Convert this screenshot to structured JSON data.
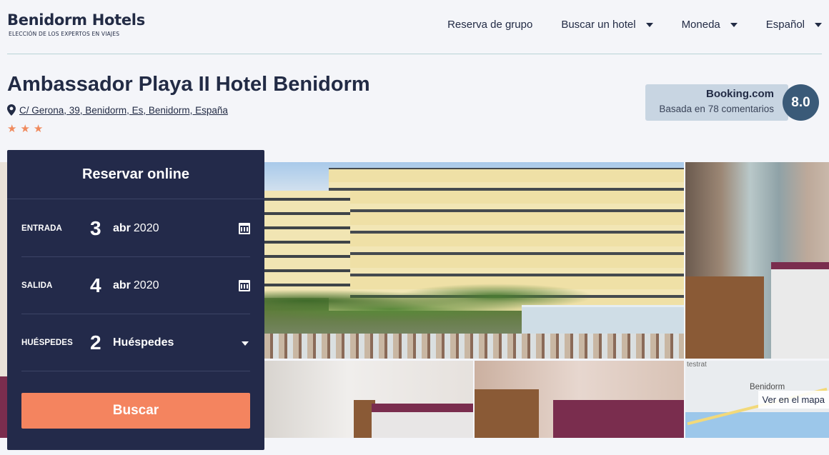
{
  "header": {
    "logo_title": "Benidorm Hotels",
    "logo_subtitle": "ELECCIÓN DE LOS EXPERTOS EN VIAJES",
    "nav": [
      {
        "label": "Reserva de grupo",
        "dropdown": false
      },
      {
        "label": "Buscar un hotel",
        "dropdown": true
      },
      {
        "label": "Moneda",
        "dropdown": true
      },
      {
        "label": "Español",
        "dropdown": true
      }
    ]
  },
  "hotel": {
    "name": "Ambassador Playa II Hotel Benidorm",
    "address": "C/ Gerona, 39, Benidorm, Es, Benidorm, España",
    "stars": 3,
    "star_color": "#f08a5d"
  },
  "rating": {
    "brand": "Booking.com",
    "reviews": "Basada en 78 comentarios",
    "score": "8.0"
  },
  "booking": {
    "title": "Reservar online",
    "checkin": {
      "label": "ENTRADA",
      "day": "3",
      "month": "abr",
      "year": "2020"
    },
    "checkout": {
      "label": "SALIDA",
      "day": "4",
      "month": "abr",
      "year": "2020"
    },
    "guests": {
      "label": "HUÉSPEDES",
      "count": "2",
      "text": "Huéspedes"
    },
    "search_label": "Buscar",
    "accent_color": "#f4845f",
    "panel_color": "#232a4a"
  },
  "gallery": {
    "map_label": "Ver en el mapa",
    "map_place": "Benidorm",
    "map_place_top": "testrat"
  }
}
